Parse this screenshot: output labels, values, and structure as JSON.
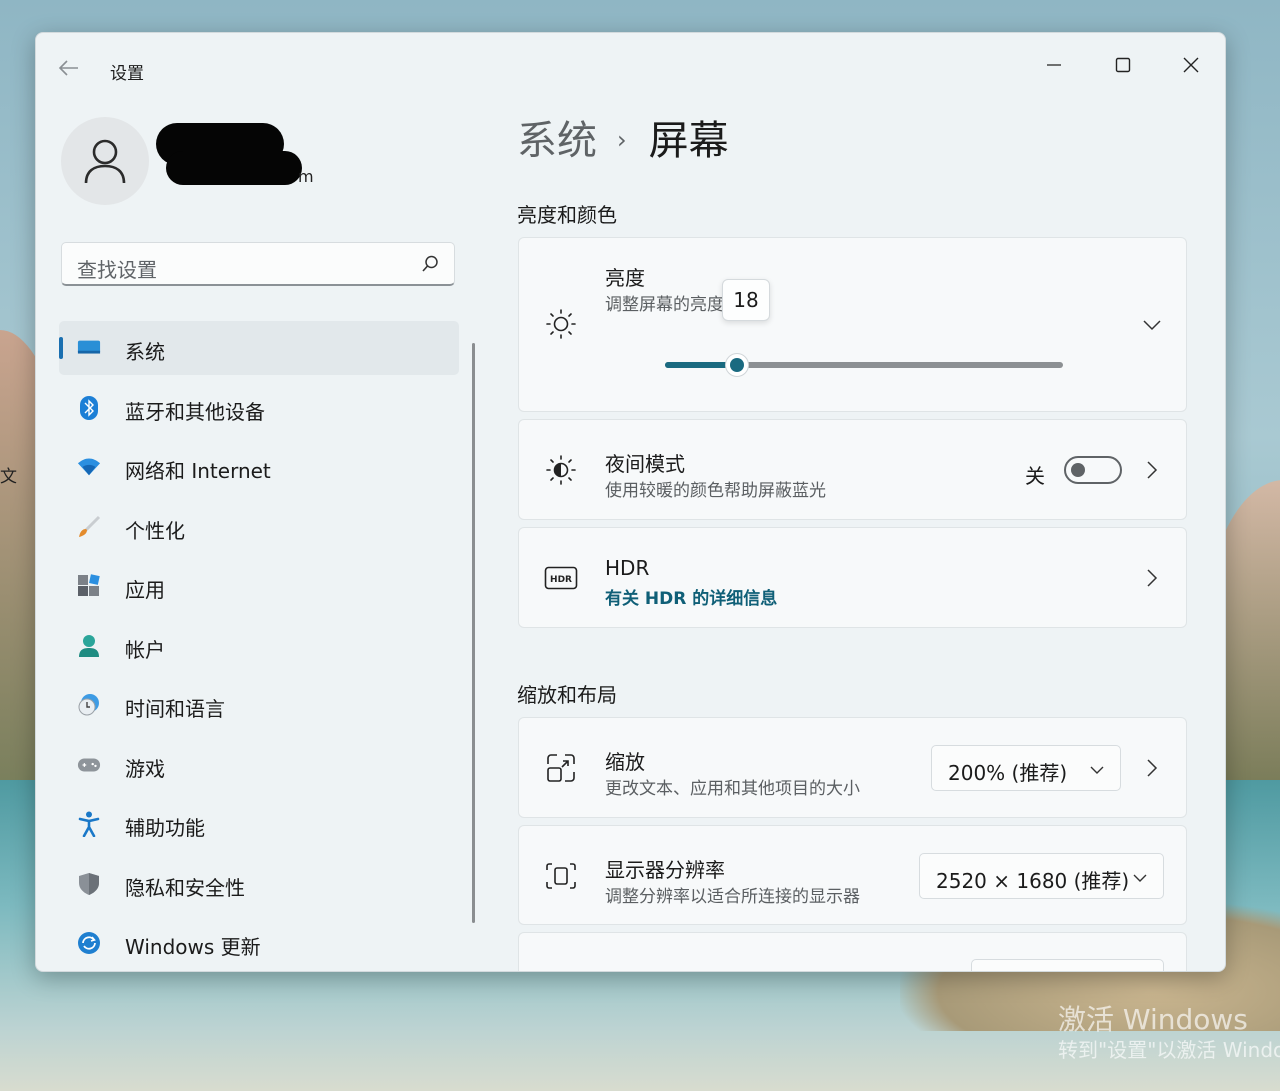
{
  "desktop": {
    "edge_text": "文",
    "watermark_line1": "激活 Windows",
    "watermark_line2": "转到\"设置\"以激活 Windows"
  },
  "window": {
    "title": "设置",
    "back_icon": "arrow-left-icon",
    "controls": [
      "minimize-icon",
      "maximize-icon",
      "close-icon"
    ]
  },
  "account": {
    "avatar_icon": "person-icon",
    "email_tail": "m"
  },
  "search": {
    "placeholder": "查找设置",
    "icon": "search-icon"
  },
  "sidebar": {
    "selected_index": 0,
    "items": [
      {
        "label": "系统",
        "icon": "monitor-icon"
      },
      {
        "label": "蓝牙和其他设备",
        "icon": "bluetooth-icon"
      },
      {
        "label": "网络和 Internet",
        "icon": "wifi-icon"
      },
      {
        "label": "个性化",
        "icon": "brush-icon"
      },
      {
        "label": "应用",
        "icon": "apps-icon"
      },
      {
        "label": "帐户",
        "icon": "account-icon"
      },
      {
        "label": "时间和语言",
        "icon": "clock-globe-icon"
      },
      {
        "label": "游戏",
        "icon": "gamepad-icon"
      },
      {
        "label": "辅助功能",
        "icon": "accessibility-icon"
      },
      {
        "label": "隐私和安全性",
        "icon": "shield-icon"
      },
      {
        "label": "Windows 更新",
        "icon": "update-icon"
      }
    ]
  },
  "breadcrumb": {
    "parent": "系统",
    "separator": "›",
    "current": "屏幕"
  },
  "sections": {
    "brightness_color": "亮度和颜色",
    "scale_layout": "缩放和布局"
  },
  "brightness": {
    "title": "亮度",
    "subtitle": "调整屏幕的亮度",
    "value": 18,
    "value_label": "18",
    "max": 100,
    "icon": "sun-icon"
  },
  "night_light": {
    "title": "夜间模式",
    "subtitle": "使用较暖的颜色帮助屏蔽蓝光",
    "state_label": "关",
    "on": false,
    "icon": "night-light-icon"
  },
  "hdr": {
    "title": "HDR",
    "link": "有关 HDR 的详细信息",
    "icon": "hdr-icon"
  },
  "scale": {
    "title": "缩放",
    "subtitle": "更改文本、应用和其他项目的大小",
    "selected": "200% (推荐)",
    "icon": "scale-icon"
  },
  "resolution": {
    "title": "显示器分辨率",
    "subtitle": "调整分辨率以适合所连接的显示器",
    "selected": "2520 × 1680 (推荐)",
    "icon": "resolution-icon"
  },
  "colors": {
    "accent": "#1a6a80",
    "indicator": "#1a6fb0",
    "window_bg": "#eef3f5"
  }
}
